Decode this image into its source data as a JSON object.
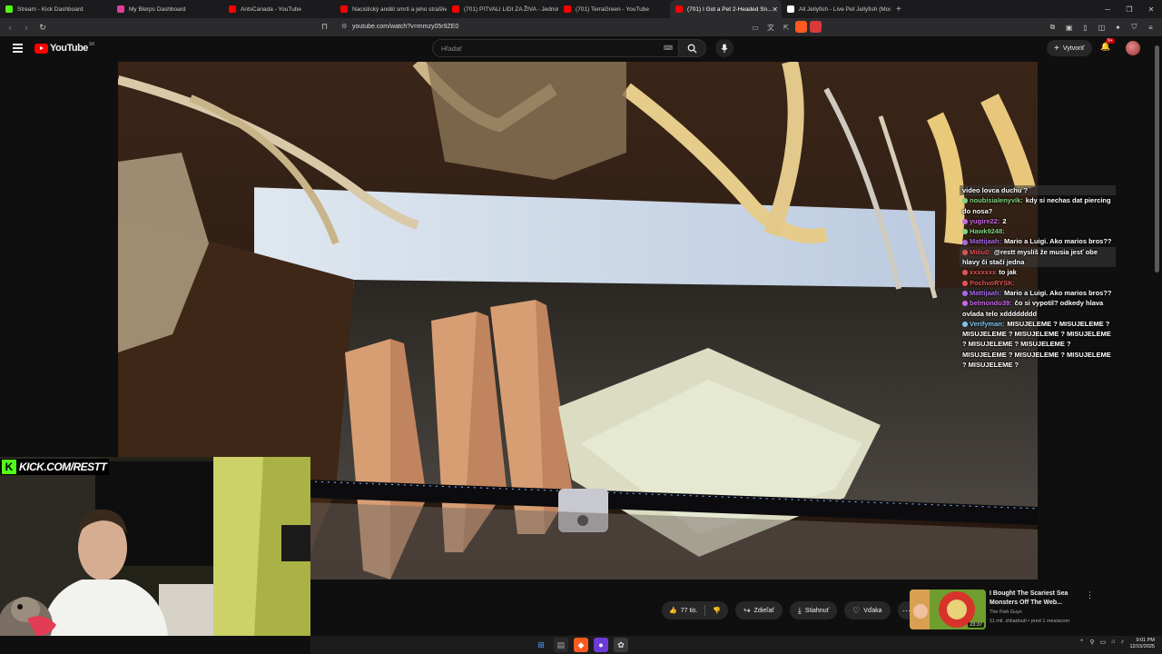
{
  "browser": {
    "tabs": [
      {
        "label": "Stream - Kick Dashboard",
        "color": "#53fc18"
      },
      {
        "label": "My Blerps Dashboard",
        "color": "#e0409a"
      },
      {
        "label": "AntsCanada - YouTube",
        "color": "#ff0000"
      },
      {
        "label": "Nacistický anděl smrti a jeho strašliv...",
        "color": "#ff0000"
      },
      {
        "label": "(701) PITVALI LIDI ZA ŽIVA - Jednotk...",
        "color": "#ff0000"
      },
      {
        "label": "(701) TerraGreen - YouTube",
        "color": "#ff0000"
      },
      {
        "label": "(701) I Got a Pet 2-Headed Sn...",
        "color": "#ff0000",
        "active": true
      },
      {
        "label": "All Jellyfish - Live Pet Jellyfish (Moon...",
        "color": "#ffffff"
      }
    ],
    "new_tab": "+",
    "url": "youtube.com/watch?v=mmzy05r9ZE0"
  },
  "youtube": {
    "logo_text": "YouTube",
    "country_code": "SK",
    "search_placeholder": "Hľadať",
    "create_label": "Vytvoriť",
    "notif_badge": "9+"
  },
  "chat": [
    {
      "user": "",
      "text": "video lovca duchu ?",
      "color": "#ffffff",
      "hl": true
    },
    {
      "user": "noubisialenyvik:",
      "text": "kdy si nechas dat piercing do nosa?",
      "color": "#7fd67f"
    },
    {
      "user": "yugire22:",
      "text": "2",
      "color": "#c869e6"
    },
    {
      "user": "Hawk9248:",
      "text": "",
      "color": "#7fd67f"
    },
    {
      "user": "Mattijaah:",
      "text": "Mario a Luigi. Ako marios bros??",
      "color": "#a56ae6"
    },
    {
      "user": "Miliu0:",
      "text": "@restt myslíš že musia jesť obe hlavy či stačí jedna",
      "color": "#e05555",
      "hl": true
    },
    {
      "user": "xxxxxxx",
      "text": "to jak",
      "color": "#e05555"
    },
    {
      "user": "PochvoRYSK:",
      "text": "",
      "color": "#e05555"
    },
    {
      "user": "Mattijaah:",
      "text": "Mario a Luigi. Ako marios bros??",
      "color": "#a56ae6"
    },
    {
      "user": "belmondo39:",
      "text": "čo si vypotil? odkedy hlava ovlada telo xdddddddd",
      "color": "#c869e6"
    },
    {
      "user": "Verifyman:",
      "text": "MISUJELEME ? MISUJELEME ? MISUJELEME ? MISUJELEME ? MISUJELEME ? MISUJELEME ? MISUJELEME ? MISUJELEME ? MISUJELEME ? MISUJELEME ? MISUJELEME ?",
      "color": "#7fc6f0"
    }
  ],
  "overlay": {
    "kick_text": "KICK.COM/RESTT"
  },
  "actions": {
    "likes": "77 tis.",
    "share": "Zdieľať",
    "download": "Stiahnuť",
    "thanks": "Vďaka"
  },
  "recommendation": {
    "title": "I Bought The Scariest Sea Monsters Off The Web...",
    "channel": "The Fish Guys",
    "meta": "11 mil. zhliadnutí • pred 1 mesiacom",
    "duration": "23:37"
  },
  "taskbar": {
    "time": "9:01 PM",
    "date": "12/15/2025"
  }
}
